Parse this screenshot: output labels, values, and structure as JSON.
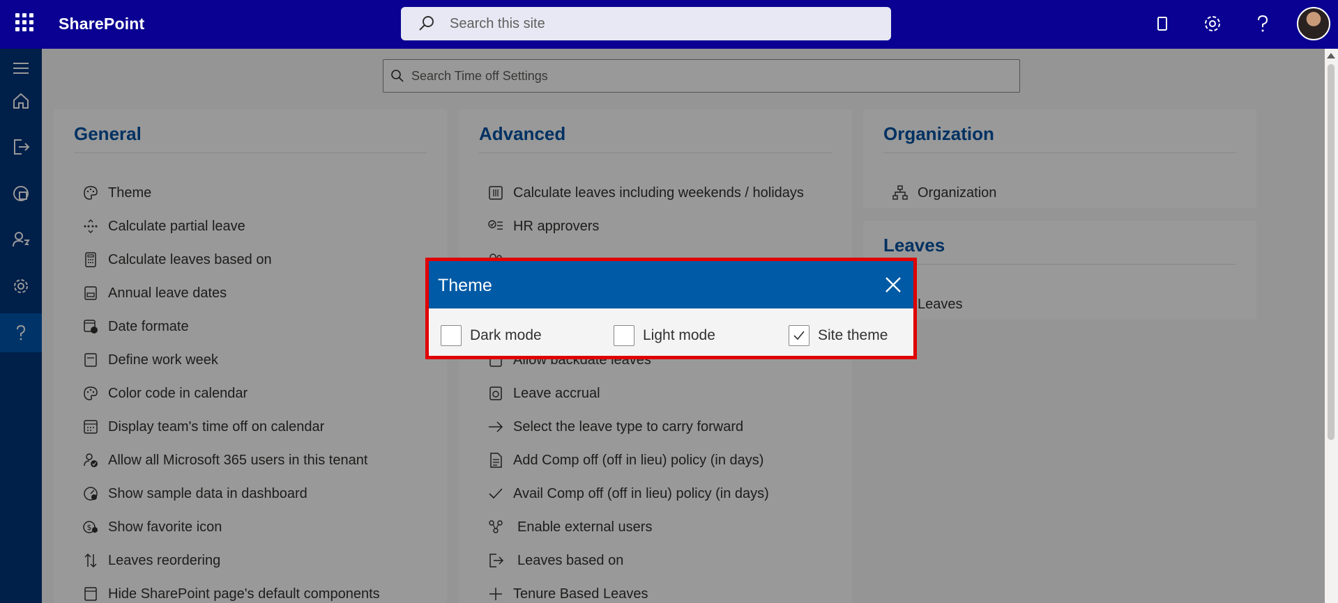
{
  "app": {
    "brand": "SharePoint"
  },
  "header": {
    "search_placeholder": "Search this site"
  },
  "settings_search": {
    "placeholder": "Search Time off Settings"
  },
  "cards": {
    "general": {
      "title": "General",
      "items": [
        "Theme",
        "Calculate partial leave",
        "Calculate leaves based on",
        "Annual leave dates",
        "Date formate",
        "Define work week",
        "Color code in calendar",
        "Display team's time off on calendar",
        "Allow all Microsoft 365 users in this tenant",
        "Show sample data in dashboard",
        "Show favorite icon",
        "Leaves reordering",
        "Hide SharePoint page's default components"
      ]
    },
    "advanced": {
      "title": "Advanced",
      "items": [
        "Calculate leaves including weekends / holidays",
        "HR approvers",
        "Allow backdate leaves",
        "Leave accrual",
        "Select the leave type to carry forward",
        "Add Comp off (off in lieu) policy (in days)",
        "Avail Comp off (off in lieu) policy (in days)",
        "Enable external users",
        "Leaves based on",
        "Tenure Based Leaves"
      ]
    },
    "organization": {
      "title": "Organization",
      "items": [
        "Organization"
      ]
    },
    "leaves": {
      "title": "Leaves",
      "items": [
        "Leaves"
      ]
    }
  },
  "dialog": {
    "title": "Theme",
    "options": [
      {
        "label": "Dark mode",
        "checked": false
      },
      {
        "label": "Light mode",
        "checked": false
      },
      {
        "label": "Site theme",
        "checked": true
      }
    ]
  }
}
